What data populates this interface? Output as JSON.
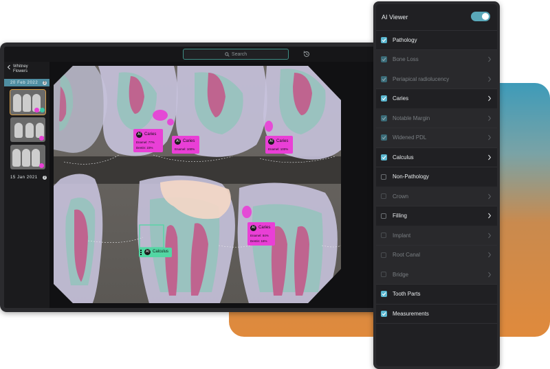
{
  "tablet": {
    "search_label": "Search",
    "patient": {
      "first": "Whitney",
      "last": "Flowers"
    },
    "dates": [
      {
        "label": "20 Feb 2022",
        "count": "3"
      },
      {
        "label": "15 Jan 2021",
        "count": "2"
      }
    ],
    "annotations": [
      {
        "title": "Caries",
        "line1": "Enamel: 77%",
        "line2": "Dentin: 23%",
        "ai": "AI"
      },
      {
        "title": "Caries",
        "line1": "Enamel: 100%",
        "ai": "AI"
      },
      {
        "title": "Caries",
        "line1": "Enamel: 100%",
        "ai": "AI"
      },
      {
        "title": "Caries",
        "line1": "Enamel: 84%",
        "line2": "Dentin: 16%",
        "ai": "AI"
      },
      {
        "title": "Calculus",
        "ai": "AI"
      }
    ],
    "colors": {
      "caries": "#e93fd6",
      "calculus": "#52d6a3",
      "accent": "#5aa8b9"
    }
  },
  "panel": {
    "title": "AI Viewer",
    "toggle_on": true,
    "items": [
      {
        "label": "Pathology",
        "checked": true,
        "dim": false,
        "chevron": false
      },
      {
        "label": "Bone Loss",
        "checked": true,
        "dim": true,
        "chevron": true
      },
      {
        "label": "Periapical radiolucency",
        "checked": true,
        "dim": true,
        "chevron": true
      },
      {
        "label": "Caries",
        "checked": true,
        "dim": false,
        "chevron": true
      },
      {
        "label": "Notable Margin",
        "checked": true,
        "dim": true,
        "chevron": true
      },
      {
        "label": "Widened PDL",
        "checked": true,
        "dim": true,
        "chevron": true
      },
      {
        "label": "Calculus",
        "checked": true,
        "dim": false,
        "chevron": true
      },
      {
        "label": "Non-Pathology",
        "checked": false,
        "dim": false,
        "chevron": false
      },
      {
        "label": "Crown",
        "checked": false,
        "dim": true,
        "chevron": true
      },
      {
        "label": "Filling",
        "checked": false,
        "dim": false,
        "chevron": true
      },
      {
        "label": "Implant",
        "checked": false,
        "dim": true,
        "chevron": true
      },
      {
        "label": "Root Canal",
        "checked": false,
        "dim": true,
        "chevron": true
      },
      {
        "label": "Bridge",
        "checked": false,
        "dim": true,
        "chevron": true
      },
      {
        "label": "Tooth Parts",
        "checked": true,
        "dim": false,
        "chevron": false
      },
      {
        "label": "Measurements",
        "checked": true,
        "dim": false,
        "chevron": false
      }
    ]
  }
}
